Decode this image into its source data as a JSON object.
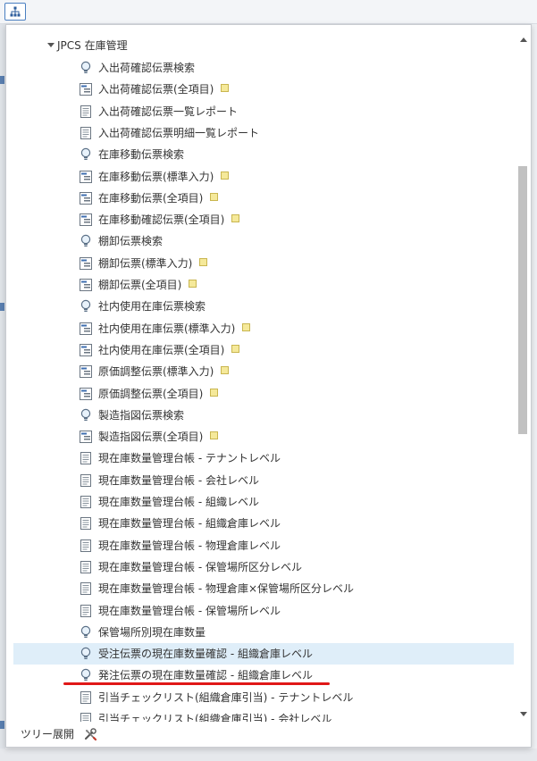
{
  "toolbar": {
    "sitemap_icon": "sitemap-icon"
  },
  "tree": {
    "root_label": "JPCS 在庫管理",
    "items": [
      {
        "label": "入出荷確認伝票検索",
        "icon": "lightbulb-icon",
        "note": false
      },
      {
        "label": "入出荷確認伝票(全項目)",
        "icon": "form-icon",
        "note": true
      },
      {
        "label": "入出荷確認伝票一覧レポート",
        "icon": "report-icon",
        "note": false
      },
      {
        "label": "入出荷確認伝票明細一覧レポート",
        "icon": "report-icon",
        "note": false
      },
      {
        "label": "在庫移動伝票検索",
        "icon": "lightbulb-icon",
        "note": false
      },
      {
        "label": "在庫移動伝票(標準入力)",
        "icon": "form-icon",
        "note": true
      },
      {
        "label": "在庫移動伝票(全項目)",
        "icon": "form-icon",
        "note": true
      },
      {
        "label": "在庫移動確認伝票(全項目)",
        "icon": "form-icon",
        "note": true
      },
      {
        "label": "棚卸伝票検索",
        "icon": "lightbulb-icon",
        "note": false
      },
      {
        "label": "棚卸伝票(標準入力)",
        "icon": "form-icon",
        "note": true
      },
      {
        "label": "棚卸伝票(全項目)",
        "icon": "form-icon",
        "note": true
      },
      {
        "label": "社内使用在庫伝票検索",
        "icon": "lightbulb-icon",
        "note": false
      },
      {
        "label": "社内使用在庫伝票(標準入力)",
        "icon": "form-icon",
        "note": true
      },
      {
        "label": "社内使用在庫伝票(全項目)",
        "icon": "form-icon",
        "note": true
      },
      {
        "label": "原価調整伝票(標準入力)",
        "icon": "form-icon",
        "note": true
      },
      {
        "label": "原価調整伝票(全項目)",
        "icon": "form-icon",
        "note": true
      },
      {
        "label": "製造指図伝票検索",
        "icon": "lightbulb-icon",
        "note": false
      },
      {
        "label": "製造指図伝票(全項目)",
        "icon": "form-icon",
        "note": true
      },
      {
        "label": "現在庫数量管理台帳 - テナントレベル",
        "icon": "report-icon",
        "note": false
      },
      {
        "label": "現在庫数量管理台帳 - 会社レベル",
        "icon": "report-icon",
        "note": false
      },
      {
        "label": "現在庫数量管理台帳 - 組織レベル",
        "icon": "report-icon",
        "note": false
      },
      {
        "label": "現在庫数量管理台帳 - 組織倉庫レベル",
        "icon": "report-icon",
        "note": false
      },
      {
        "label": "現在庫数量管理台帳 - 物理倉庫レベル",
        "icon": "report-icon",
        "note": false
      },
      {
        "label": "現在庫数量管理台帳 - 保管場所区分レベル",
        "icon": "report-icon",
        "note": false
      },
      {
        "label": "現在庫数量管理台帳 - 物理倉庫×保管場所区分レベル",
        "icon": "report-icon",
        "note": false
      },
      {
        "label": "現在庫数量管理台帳 - 保管場所レベル",
        "icon": "report-icon",
        "note": false
      },
      {
        "label": "保管場所別現在庫数量",
        "icon": "lightbulb-icon",
        "note": false
      },
      {
        "label": "受注伝票の現在庫数量確認 - 組織倉庫レベル",
        "icon": "lightbulb-icon",
        "note": false,
        "selected": true
      },
      {
        "label": "発注伝票の現在庫数量確認 - 組織倉庫レベル",
        "icon": "lightbulb-icon",
        "note": false
      },
      {
        "label": "引当チェックリスト(組織倉庫引当) - テナントレベル",
        "icon": "report-icon",
        "note": false
      },
      {
        "label": "引当チェックリスト(組織倉庫引当) - 会社レベル",
        "icon": "report-icon",
        "note": false
      }
    ]
  },
  "footer": {
    "expand_label": "ツリー展開",
    "tools_icon": "tools-icon"
  },
  "colors": {
    "selected_bg": "#dfeef9",
    "highlight_line": "#e01818",
    "accent": "#4a7fc1"
  }
}
